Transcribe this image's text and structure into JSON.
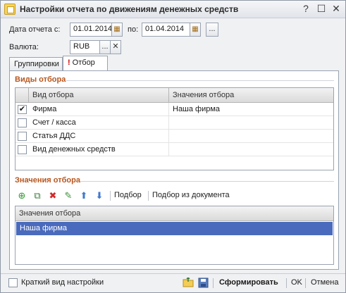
{
  "window": {
    "title": "Настройки отчета по движениям денежных средств",
    "help_label": "?",
    "maximize_label": "☐",
    "close_label": "✕"
  },
  "form": {
    "date_from_label": "Дата отчета с:",
    "date_from_value": "01.01.2014",
    "date_to_label": "по:",
    "date_to_value": "01.04.2014",
    "period_button_label": "...",
    "currency_label": "Валюта:",
    "currency_value": "RUB",
    "currency_select_label": "...",
    "currency_clear_label": "✕"
  },
  "tabs": [
    {
      "label": "Группировки",
      "active": false
    },
    {
      "label": "Отбор",
      "active": true,
      "marker": "!"
    }
  ],
  "filter_types": {
    "title": "Виды отбора",
    "columns": [
      "Вид отбора",
      "Значения отбора"
    ],
    "rows": [
      {
        "checked": true,
        "name": "Фирма",
        "value": "Наша фирма"
      },
      {
        "checked": false,
        "name": "Счет / касса",
        "value": ""
      },
      {
        "checked": false,
        "name": "Статья ДДС",
        "value": ""
      },
      {
        "checked": false,
        "name": "Вид денежных средств",
        "value": ""
      }
    ]
  },
  "filter_values": {
    "title": "Значения отбора",
    "toolbar": {
      "add_icon": "add-icon",
      "copy_icon": "copy-icon",
      "delete_icon": "delete-icon",
      "edit_icon": "pencil-icon",
      "up_icon": "arrow-up-icon",
      "down_icon": "arrow-down-icon",
      "pick_label": "Подбор",
      "pick_from_doc_label": "Подбор из документа"
    },
    "column": "Значения отбора",
    "rows": [
      "Наша фирма"
    ]
  },
  "footer": {
    "short_view_label": "Краткий вид настройки",
    "generate_label": "Сформировать",
    "ok_label": "OK",
    "cancel_label": "Отмена"
  },
  "colors": {
    "section_title": "#b7561e",
    "selection": "#4a6bbd",
    "warning_marker": "#d00000"
  }
}
